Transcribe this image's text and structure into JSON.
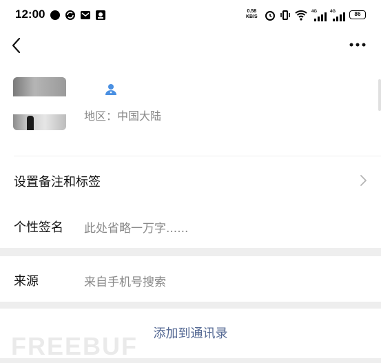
{
  "status_bar": {
    "time": "12:00",
    "net_speed_value": "0.58",
    "net_speed_unit": "KB/S",
    "signal_1": "4G",
    "signal_2": "4G",
    "battery": "86"
  },
  "nav": {
    "back_icon": "chevron-left-icon",
    "more_icon": "ellipsis-icon",
    "title": ""
  },
  "profile": {
    "avatar_icon": "avatar-image",
    "gender_icon": "user-icon",
    "accent_color": "#4a90e2",
    "region": "地区：中国大陆"
  },
  "rows": {
    "remark_label": "设置备注和标签",
    "signature_label": "个性签名",
    "signature_value": "此处省略一万字......",
    "source_label": "来源",
    "source_value": "来自手机号搜索"
  },
  "action": {
    "add_contact": "添加到通讯录",
    "link_color": "#576b95"
  },
  "watermark": "FREEBUF"
}
